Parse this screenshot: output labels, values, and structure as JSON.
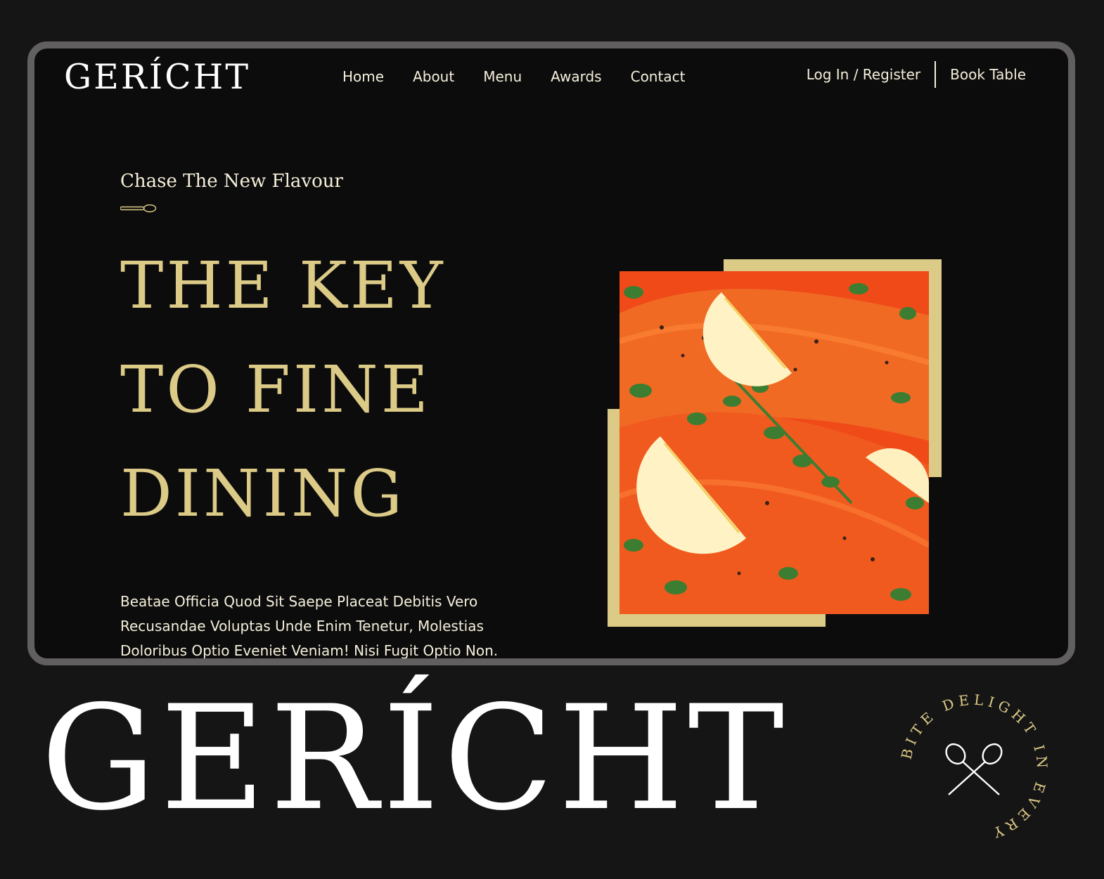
{
  "brand": {
    "logo": "GERÍCHT"
  },
  "nav": {
    "links": [
      "Home",
      "About",
      "Menu",
      "Awards",
      "Contact"
    ],
    "login": "Log In / Register",
    "book": "Book Table"
  },
  "hero": {
    "subtitle": "Chase The New Flavour",
    "headline": [
      "THE KEY",
      "TO FINE",
      "DINING"
    ],
    "description": "Beatae Officia Quod Sit Saepe Placeat Debitis Vero Recusandae Voluptas Unde Enim Tenetur, Molestias Doloribus Optio Eveniet Veniam! Nisi Fugit Optio Non.",
    "image_icon": "salmon-dish-photo"
  },
  "footer": {
    "wordmark": "GERÍCHT",
    "seal_text": "BITE DELIGHT IN EVERY",
    "seal_icon": "crossed-spoons-icon"
  },
  "colors": {
    "background": "#151515",
    "panel": "#0c0c0c",
    "frame": "#625f60",
    "gold": "#dcca87",
    "text": "#f5efdb",
    "white": "#ffffff"
  }
}
